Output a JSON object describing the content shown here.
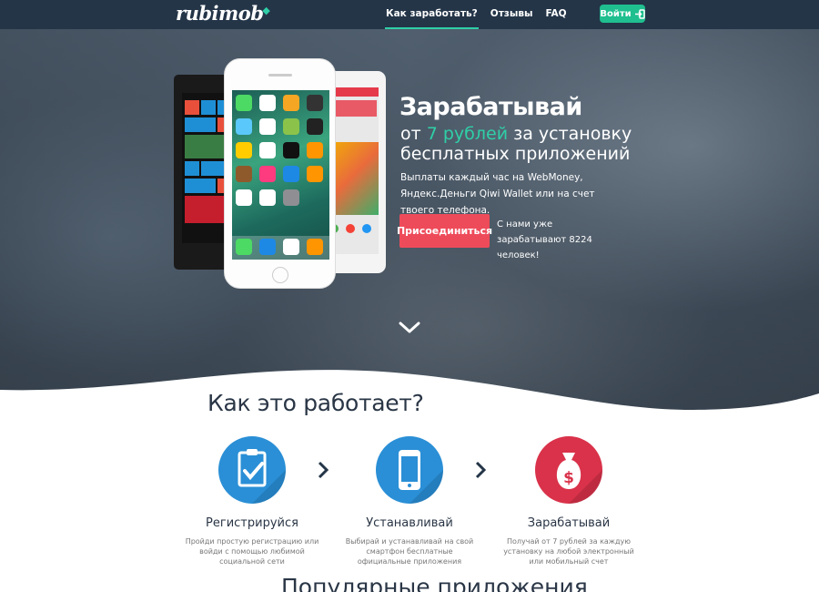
{
  "nav": {
    "logo": "rubimob",
    "logo_gem": "◆",
    "links": [
      {
        "label": "Как заработать?",
        "active": true
      },
      {
        "label": "Отзывы"
      },
      {
        "label": "FAQ"
      }
    ],
    "login_label": "Войти",
    "login_icon": "sign-in-icon"
  },
  "hero": {
    "title": "Зарабатывай",
    "sub_prefix": "от ",
    "sub_accent": "7 рублей",
    "sub_suffix": " за установку бесплатных приложений",
    "desc": "Выплаты каждый час на WebMoney, Яндекс.Деньги Qiwi Wallet или на счет твоего телефона.",
    "join_label": "Присоединиться",
    "join_note": "С нами уже зарабатывают 8224 человек!",
    "colors": {
      "accent": "#2fcfa7",
      "join": "#ee4b5a",
      "nav": "#243548"
    }
  },
  "how": {
    "title": "Как это работает?",
    "steps": [
      {
        "label": "Регистрируйся",
        "text": "Пройди простую регистрацию или войди с помощью любимой социальной сети",
        "icon": "clipboard-check-icon",
        "color": "#2a8fd6"
      },
      {
        "label": "Устанавливай",
        "text": "Выбирай и устанавливай на свой смартфон бесплатные официальные приложения",
        "icon": "smartphone-icon",
        "color": "#2a8fd6"
      },
      {
        "label": "Зарабатывай",
        "text": "Получай от 7 рублей за каждую установку на любой электронный или мобильный счет",
        "icon": "money-bag-icon",
        "color": "#d9324a"
      }
    ]
  },
  "popular": {
    "title": "Популярные приложения"
  }
}
